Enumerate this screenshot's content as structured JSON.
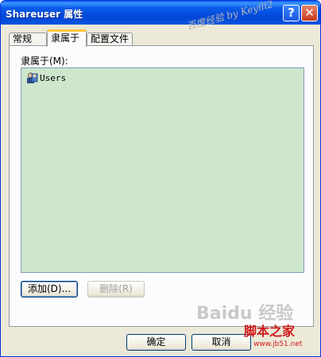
{
  "window": {
    "title": "Shareuser 属性",
    "help_glyph": "?",
    "close_glyph": "✕"
  },
  "tabs": [
    {
      "label": "常规",
      "active": false
    },
    {
      "label": "隶属于",
      "active": true
    },
    {
      "label": "配置文件",
      "active": false
    }
  ],
  "member_of": {
    "label": "隶属于(M):",
    "items": [
      {
        "name": "Users",
        "icon": "group-icon"
      }
    ]
  },
  "buttons": {
    "add": "添加(D)...",
    "remove": "删除(R)",
    "ok": "确定",
    "cancel": "取消"
  },
  "overlays": {
    "watermark": "百度经验 by Keyili2",
    "baidu_logo": "Baidu 经验",
    "site_logo": "脚本之家",
    "site_url": "www.jb51.net"
  },
  "colors": {
    "titlebar": "#0054e3",
    "dialog_bg": "#ece9d8",
    "list_bg": "#cde6cc",
    "active_tab_accent": "#ffc83c",
    "site_red": "#d0181a"
  }
}
